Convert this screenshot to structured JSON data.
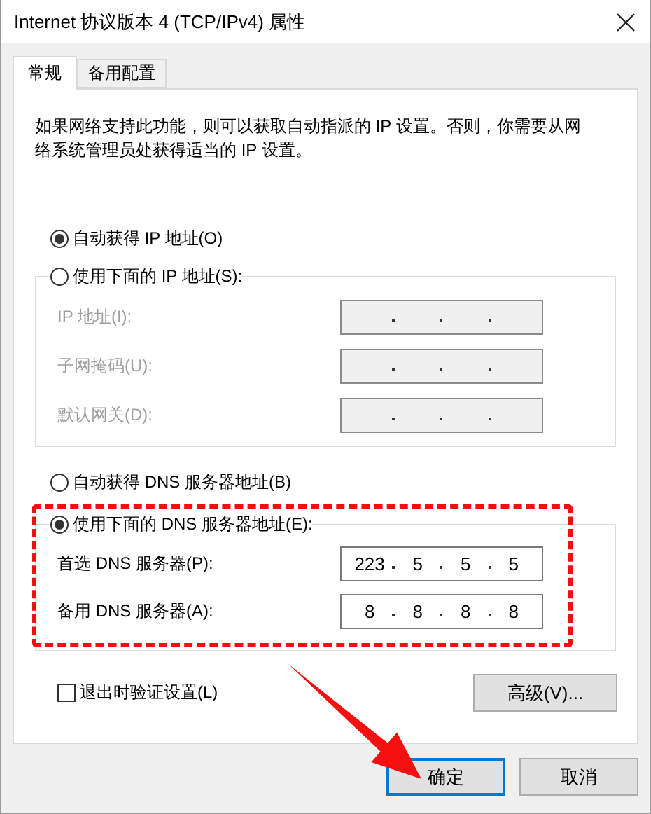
{
  "window": {
    "title": "Internet 协议版本 4 (TCP/IPv4) 属性"
  },
  "tabs": [
    {
      "label": "常规",
      "selected": true
    },
    {
      "label": "备用配置",
      "selected": false
    }
  ],
  "description": "如果网络支持此功能，则可以获取自动指派的 IP 设置。否则，你需要从网络系统管理员处获得适当的 IP 设置。",
  "ip_section": {
    "options": [
      {
        "label": "自动获得 IP 地址(O)",
        "selected": true
      },
      {
        "label": "使用下面的 IP 地址(S):",
        "selected": false
      }
    ],
    "fields": [
      {
        "label": "IP 地址(I):",
        "disabled": true
      },
      {
        "label": "子网掩码(U):",
        "disabled": true
      },
      {
        "label": "默认网关(D):",
        "disabled": true
      }
    ]
  },
  "dns_section": {
    "options": [
      {
        "label": "自动获得 DNS 服务器地址(B)",
        "selected": false
      },
      {
        "label": "使用下面的 DNS 服务器地址(E):",
        "selected": true
      }
    ],
    "fields": [
      {
        "label": "首选 DNS 服务器(P):",
        "disabled": false,
        "octets": [
          "223",
          "5",
          "5",
          "5"
        ]
      },
      {
        "label": "备用 DNS 服务器(A):",
        "disabled": false,
        "octets": [
          "8",
          "8",
          "8",
          "8"
        ]
      }
    ]
  },
  "validate_checkbox": {
    "label": "退出时验证设置(L)",
    "checked": false
  },
  "advanced_button": "高级(V)...",
  "buttons": [
    {
      "label": "确定",
      "default": true
    },
    {
      "label": "取消",
      "default": false
    }
  ],
  "highlight_frame": true,
  "pointer_arrow": true
}
